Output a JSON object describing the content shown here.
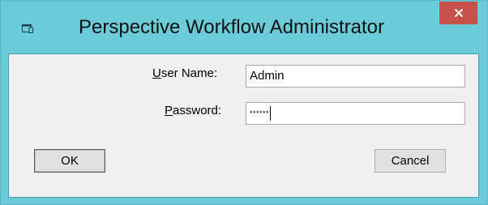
{
  "window": {
    "title": "Perspective Workflow Administrator",
    "close_symbol": "×"
  },
  "form": {
    "username_label_mnemonic": "U",
    "username_label_rest": "ser Name:",
    "username_value": "Admin",
    "password_label_mnemonic": "P",
    "password_label_rest": "assword:",
    "password_value": "******"
  },
  "buttons": {
    "ok_label": "OK",
    "cancel_label": "Cancel"
  },
  "icons": {
    "app": "app-window-icon",
    "close": "close-icon"
  },
  "colors": {
    "frame": "#6ccbd8",
    "close_button": "#c7504a",
    "client_background": "#f0f0f0"
  }
}
